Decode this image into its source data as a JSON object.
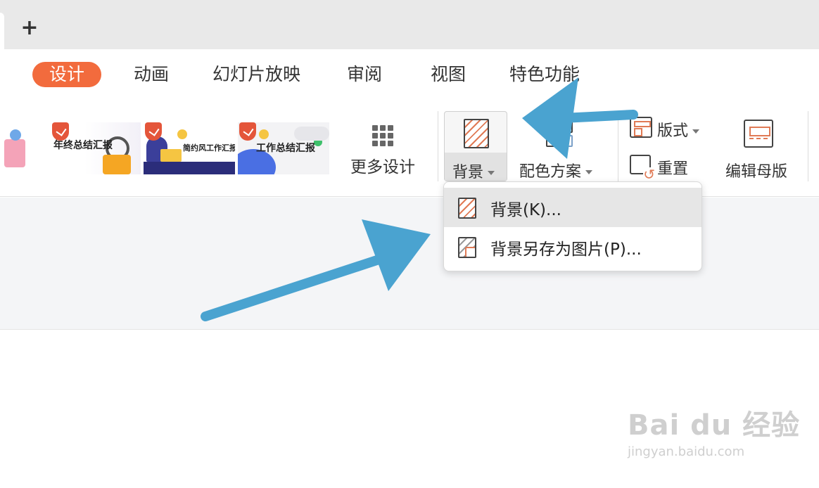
{
  "tabbar": {
    "new_tab_label": "+"
  },
  "menu": {
    "items": [
      {
        "label": "设计",
        "active": true
      },
      {
        "label": "动画",
        "active": false
      },
      {
        "label": "幻灯片放映",
        "active": false
      },
      {
        "label": "审阅",
        "active": false
      },
      {
        "label": "视图",
        "active": false
      },
      {
        "label": "特色功能",
        "active": false
      }
    ]
  },
  "ribbon": {
    "templates": [
      {
        "title": "年终总结汇报"
      },
      {
        "title": "简约风工作汇报"
      },
      {
        "title": "工作总结汇报"
      }
    ],
    "more_design_label": "更多设计",
    "background_label": "背景",
    "color_scheme_label": "配色方案",
    "layout_label": "版式",
    "reset_label": "重置",
    "edit_master_label": "编辑母版"
  },
  "dropdown": {
    "items": [
      {
        "label": "背景(K)...",
        "icon": "background-icon",
        "hovered": true
      },
      {
        "label": "背景另存为图片(P)...",
        "icon": "save-background-icon",
        "hovered": false
      }
    ]
  },
  "colors": {
    "accent": "#f26b3d",
    "arrow": "#4aa3d0",
    "icon_accent": "#e07a55"
  },
  "watermark": {
    "main": "Bai du 经验",
    "sub": "jingyan.baidu.com"
  }
}
